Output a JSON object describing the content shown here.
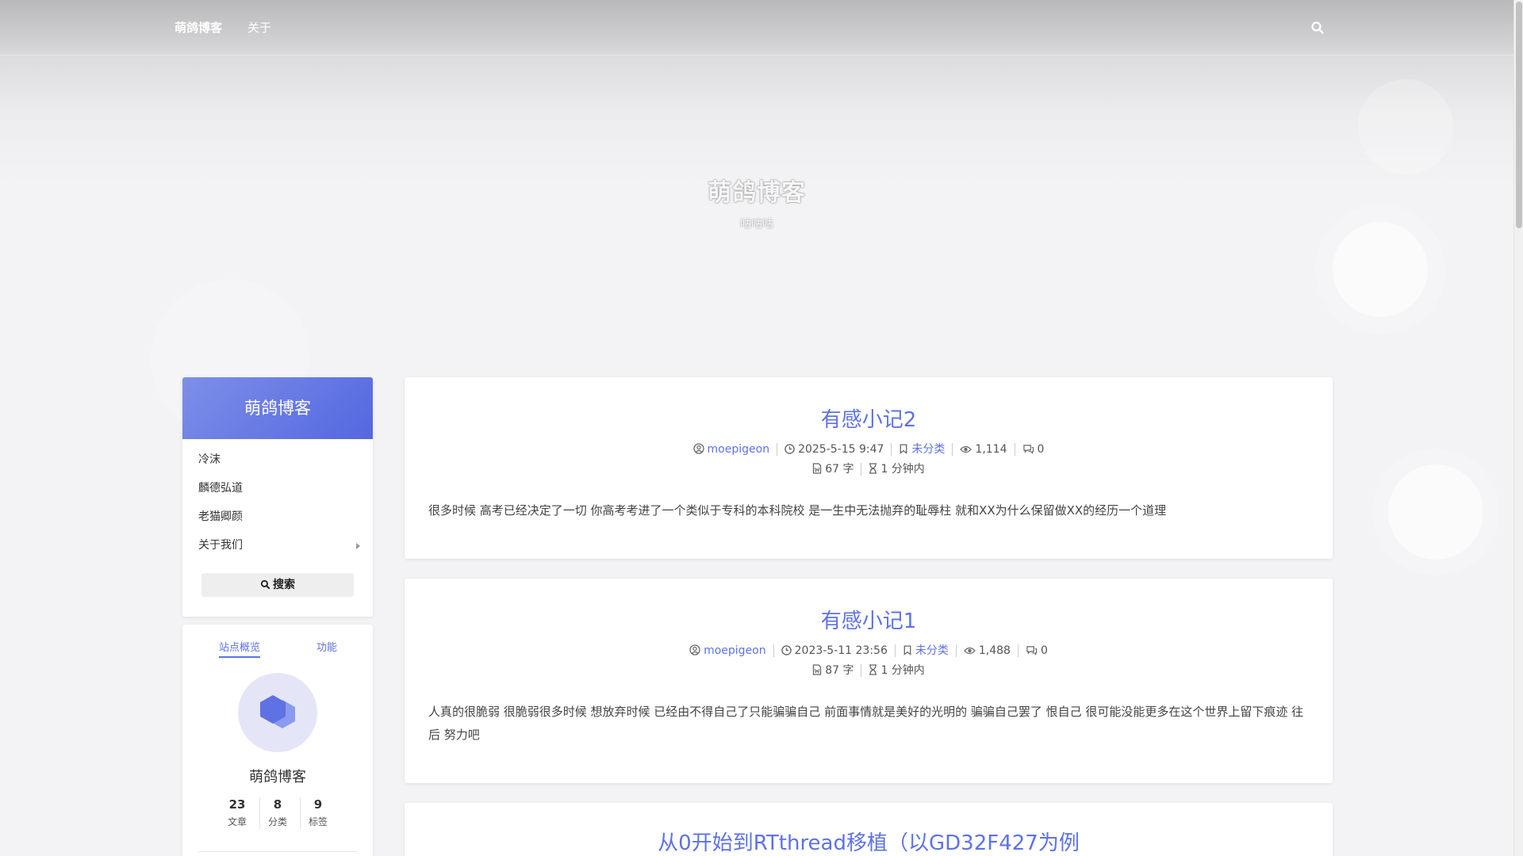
{
  "nav": {
    "brand": "萌鸽博客",
    "about": "关于"
  },
  "banner": {
    "title": "萌鸽博客",
    "subtitle": "咕咕咕"
  },
  "sidebar": {
    "menu_title": "萌鸽博客",
    "menu_items": [
      {
        "label": "冷沫"
      },
      {
        "label": "麟德弘道"
      },
      {
        "label": "老猫卿颜"
      },
      {
        "label": "关于我们"
      }
    ],
    "search_label": "搜索",
    "tabs": [
      "站点概览",
      "功能"
    ],
    "profile_name": "萌鸽博客",
    "stats": [
      {
        "num": "23",
        "label": "文章"
      },
      {
        "num": "8",
        "label": "分类"
      },
      {
        "num": "9",
        "label": "标签"
      }
    ]
  },
  "posts": [
    {
      "title": "有感小记2",
      "author": "moepigeon",
      "date": "2025-5-15 9:47",
      "category": "未分类",
      "views": "1,114",
      "comments": "0",
      "words": "67 字",
      "read_time": "1 分钟内",
      "excerpt": "很多时候 高考已经决定了一切 你高考考进了一个类似于专科的本科院校 是一生中无法抛弃的耻辱柱 就和XX为什么保留做XX的经历一个道理"
    },
    {
      "title": "有感小记1",
      "author": "moepigeon",
      "date": "2023-5-11 23:56",
      "category": "未分类",
      "views": "1,488",
      "comments": "0",
      "words": "87 字",
      "read_time": "1 分钟内",
      "excerpt": "人真的很脆弱 很脆弱很多时候 想放弃时候 已经由不得自己了只能骗骗自己 前面事情就是美好的光明的 骗骗自己罢了 恨自己 很可能没能更多在这个世界上留下痕迹 往后 努力吧"
    },
    {
      "title": "从0开始到RTthread移植（以GD32F427为例"
    }
  ],
  "colors": {
    "accent": "#5e72e4",
    "menu_gradient_start": "#7d8fe8",
    "menu_gradient_end": "#5467e0"
  }
}
